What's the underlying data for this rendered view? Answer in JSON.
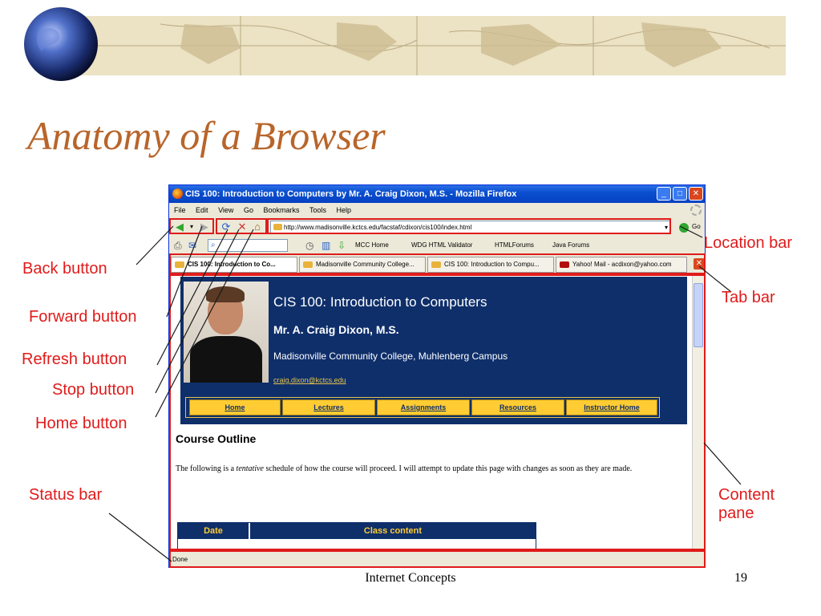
{
  "slide": {
    "title": "Anatomy of a Browser",
    "footer": "Internet Concepts",
    "page_number": "19"
  },
  "browser": {
    "window_title": "CIS 100: Introduction to Computers by Mr. A. Craig Dixon, M.S. - Mozilla Firefox",
    "window_buttons": {
      "minimize": "_",
      "maximize": "□",
      "close": "✕"
    },
    "menu": [
      "File",
      "Edit",
      "View",
      "Go",
      "Bookmarks",
      "Tools",
      "Help"
    ],
    "url": "http://www.madisonville.kctcs.edu/facstaf/cdixon/cis100/index.html",
    "go_label": "Go",
    "bookmarks": [
      "MCC Home",
      "WDG HTML Validator",
      "HTMLForums",
      "Java Forums"
    ],
    "tabs": [
      "CIS 100: Introduction to Co...",
      "Madisonville Community College...",
      "CIS 100: Introduction to Compu...",
      "Yahoo! Mail - acdixon@yahoo.com"
    ],
    "status": "Done"
  },
  "page": {
    "header_title": "CIS 100: Introduction to Computers",
    "instructor": "Mr. A. Craig Dixon, M.S.",
    "college": "Madisonville Community College, Muhlenberg Campus",
    "email": "craig.dixon@kctcs.edu",
    "nav": [
      "Home",
      "Lectures",
      "Assignments",
      "Resources",
      "Instructor Home"
    ],
    "section_heading": "Course Outline",
    "intro_before": "The following is a ",
    "intro_em": "tentative",
    "intro_after": " schedule of how the course will proceed. I will attempt to update this page with changes as soon as they are made.",
    "table_headers": [
      "Date",
      "Class content"
    ]
  },
  "callouts": {
    "back": "Back button",
    "forward": "Forward button",
    "refresh": "Refresh button",
    "stop": "Stop button",
    "home": "Home button",
    "status": "Status bar",
    "location": "Location bar",
    "tab": "Tab bar",
    "content_line1": "Content",
    "content_line2": "pane"
  },
  "colors": {
    "accent_red": "#e01b1b",
    "title_brown": "#b8652a",
    "page_navy": "#0f2f6b",
    "page_gold": "#ffcc33"
  }
}
